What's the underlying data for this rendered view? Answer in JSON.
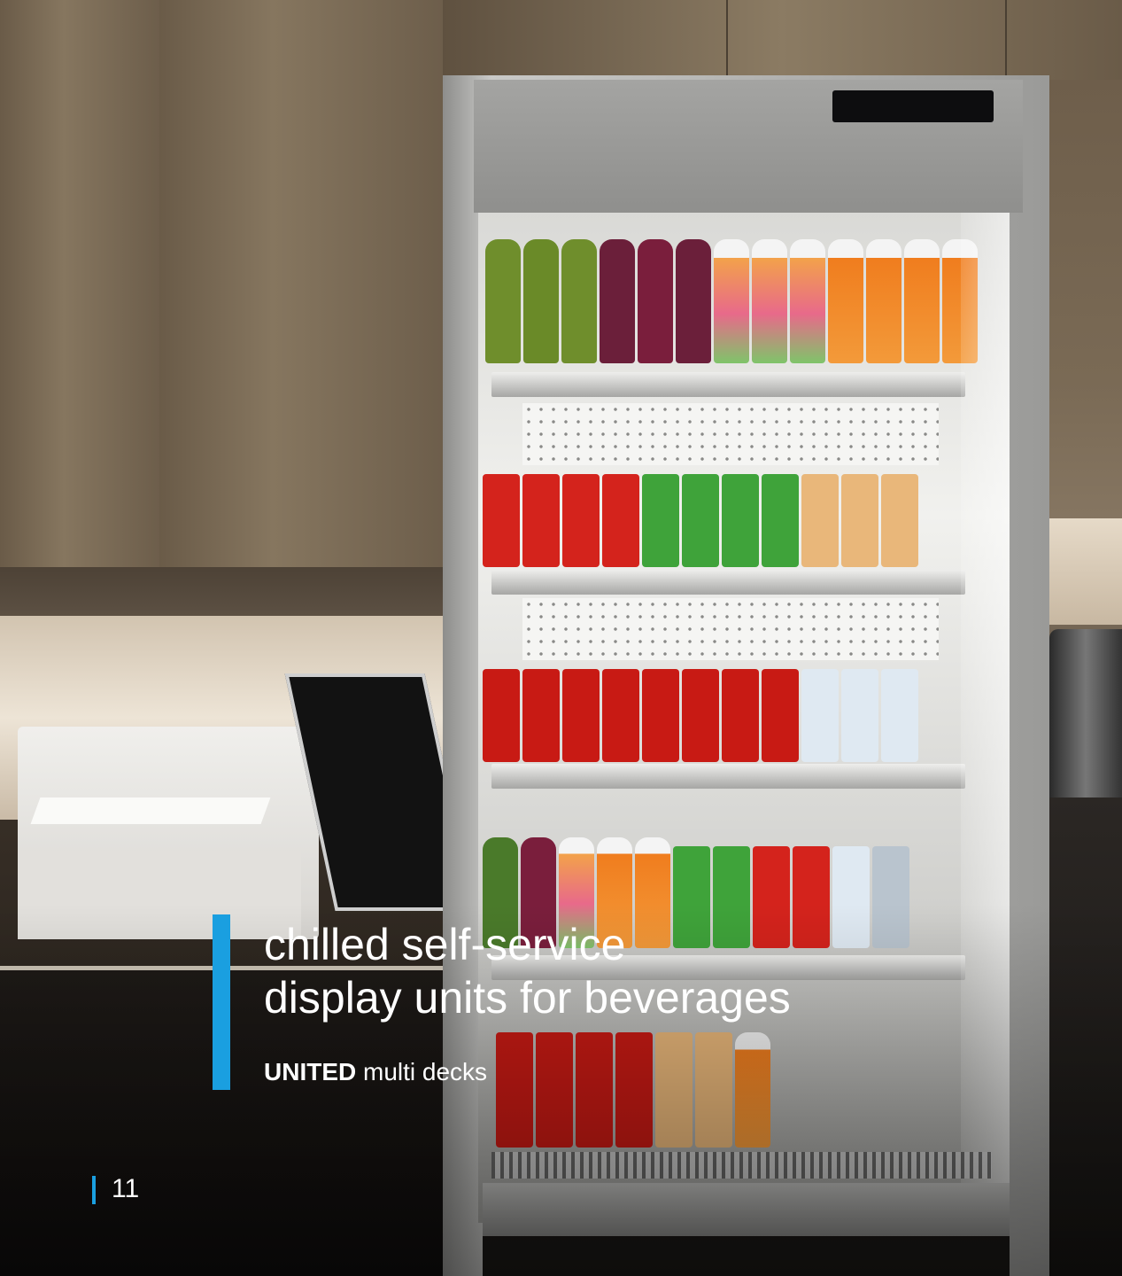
{
  "headline": {
    "line1": "chilled self-service",
    "line2": "display units for beverages"
  },
  "subline": {
    "brand": "UNITED",
    "rest": " multi decks"
  },
  "page_number": "11",
  "colors": {
    "accent": "#1a9fe0",
    "text": "#ffffff"
  }
}
